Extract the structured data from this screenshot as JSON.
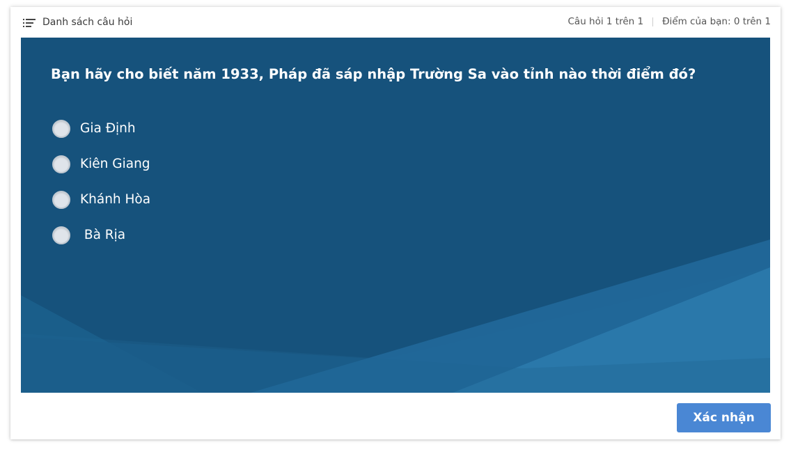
{
  "header": {
    "question_list_label": "Danh sách câu hỏi",
    "question_counter": "Câu hỏi 1 trên 1",
    "score_text": "Điểm của bạn: 0 trên 1"
  },
  "quiz": {
    "question": "Bạn hãy cho biết năm 1933, Pháp đã sáp nhập Trường Sa vào tỉnh nào thời điểm đó?",
    "options": [
      {
        "label": "Gia Định"
      },
      {
        "label": "Kiên Giang"
      },
      {
        "label": "Khánh Hòa"
      },
      {
        "label": " Bà Rịa"
      }
    ]
  },
  "footer": {
    "submit_label": "Xác nhận"
  },
  "colors": {
    "stage_background": "#16527c",
    "submit_button": "#4a87d4"
  },
  "icons": {
    "question_list": "list-icon"
  }
}
